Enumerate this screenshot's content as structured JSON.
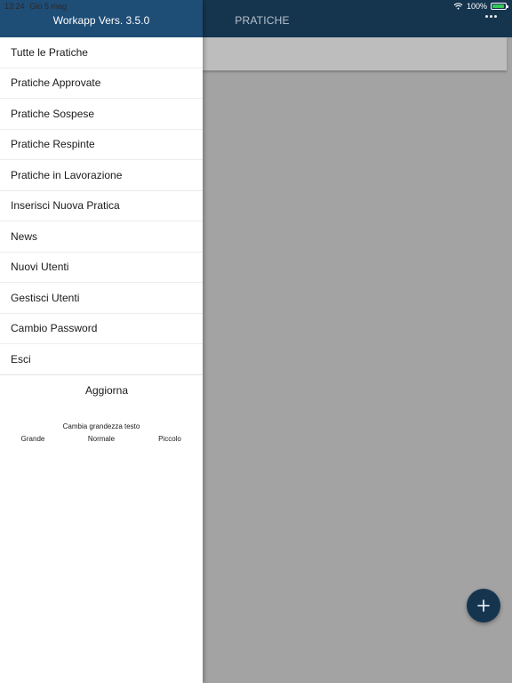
{
  "status_bar": {
    "time": "13:24",
    "date": "Gio 5 mag",
    "battery": "100%"
  },
  "app": {
    "title": "PRATICHE"
  },
  "drawer": {
    "title": "Workapp Vers. 3.5.0",
    "items": [
      {
        "label": "Tutte le Pratiche"
      },
      {
        "label": "Pratiche Approvate"
      },
      {
        "label": "Pratiche Sospese"
      },
      {
        "label": "Pratiche Respinte"
      },
      {
        "label": "Pratiche in Lavorazione"
      },
      {
        "label": "Inserisci Nuova Pratica"
      },
      {
        "label": "News"
      },
      {
        "label": "Nuovi Utenti"
      },
      {
        "label": "Gestisci Utenti"
      },
      {
        "label": "Cambio Password"
      },
      {
        "label": "Esci"
      }
    ],
    "refresh_label": "Aggiorna",
    "text_size": {
      "label": "Cambia grandezza testo",
      "options": [
        "Grande",
        "Normale",
        "Piccolo"
      ]
    }
  },
  "icons": {
    "more": "more-horizontal-icon",
    "fab": "plus-icon",
    "wifi": "wifi-icon",
    "battery": "battery-icon"
  },
  "colors": {
    "header": "#15354f",
    "drawer_header": "#1e4d76",
    "fab": "#15354f",
    "battery": "#34c759"
  }
}
